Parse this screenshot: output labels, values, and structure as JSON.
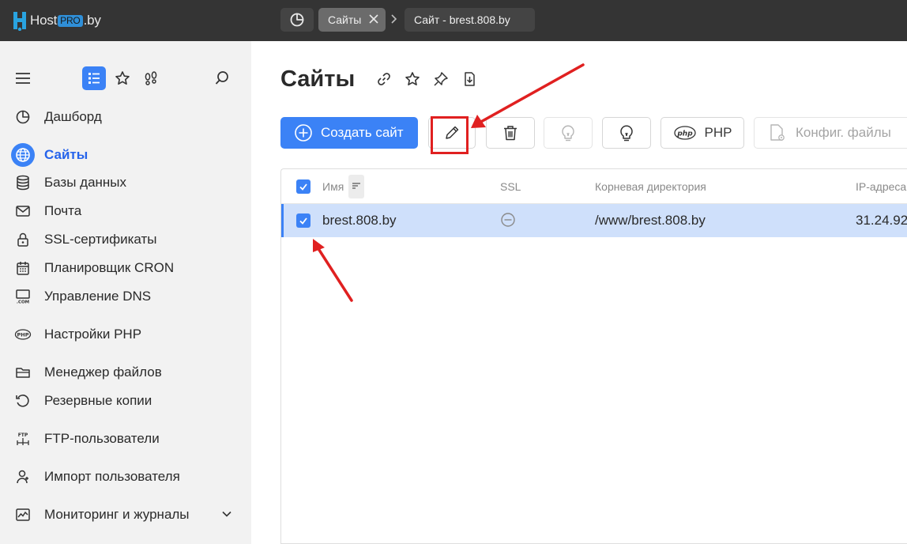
{
  "topbar": {
    "logo": {
      "text_host": "Host",
      "text_pro": "PRO",
      "text_tld": ".by"
    },
    "tabs": [
      {
        "label": "Сайты",
        "active": true
      },
      {
        "label": "Сайт - brest.808.by"
      }
    ]
  },
  "sidebar": {
    "items": [
      {
        "label": "Дашборд",
        "icon": "dashboard-icon"
      },
      {
        "label": "Сайты",
        "icon": "globe-icon",
        "active": true
      },
      {
        "label": "Базы данных",
        "icon": "database-icon"
      },
      {
        "label": "Почта",
        "icon": "mail-icon"
      },
      {
        "label": "SSL-сертификаты",
        "icon": "lock-icon"
      },
      {
        "label": "Планировщик CRON",
        "icon": "calendar-icon"
      },
      {
        "label": "Управление DNS",
        "icon": "dns-icon"
      },
      {
        "label": "Настройки PHP",
        "icon": "php-icon"
      },
      {
        "label": "Менеджер файлов",
        "icon": "folder-icon"
      },
      {
        "label": "Резервные копии",
        "icon": "backup-icon"
      },
      {
        "label": "FTP-пользователи",
        "icon": "ftp-icon"
      },
      {
        "label": "Импорт пользователя",
        "icon": "user-import-icon"
      },
      {
        "label": "Мониторинг и журналы",
        "icon": "monitoring-icon",
        "expandable": true
      }
    ]
  },
  "main": {
    "title": "Сайты",
    "toolbar": {
      "create_label": "Создать сайт",
      "php_label": "PHP",
      "config_label": "Конфиг. файлы"
    },
    "table": {
      "columns": [
        "Имя",
        "SSL",
        "Корневая директория",
        "IP-адреса"
      ],
      "rows": [
        {
          "name": "brest.808.by",
          "ssl": "none",
          "root": "/www/brest.808.by",
          "ip": "31.24.92"
        }
      ]
    }
  },
  "colors": {
    "accent": "#3b82f6",
    "topbar": "#343434",
    "sidebar": "#f2f2f2",
    "selected_row": "#cfe0fb",
    "annotation": "#e02020"
  }
}
